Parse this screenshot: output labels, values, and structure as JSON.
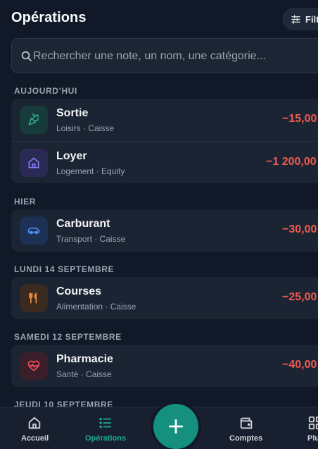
{
  "header": {
    "title": "Opérations",
    "filter_label": "Filtrer"
  },
  "search": {
    "placeholder": "Rechercher une note, un nom, une catégorie..."
  },
  "sections": [
    {
      "label": "AUJOURD’HUI",
      "items": [
        {
          "title": "Sortie",
          "subtitle": "Loisirs · Caisse",
          "amount": "−15,00",
          "icon": "party-popper-icon",
          "icon_color": "#2fb39a",
          "icon_bg": "#173b3a"
        },
        {
          "title": "Loyer",
          "subtitle": "Logement · Equity",
          "amount": "−1 200,00",
          "icon": "home-icon",
          "icon_color": "#8b7cf6",
          "icon_bg": "#2a2a55"
        }
      ]
    },
    {
      "label": "HIER",
      "items": [
        {
          "title": "Carburant",
          "subtitle": "Transport · Caisse",
          "amount": "−30,00",
          "icon": "car-icon",
          "icon_color": "#4a8ef0",
          "icon_bg": "#1c3154"
        }
      ]
    },
    {
      "label": "LUNDI 14 SEPTEMBRE",
      "items": [
        {
          "title": "Courses",
          "subtitle": "Alimentation · Caisse",
          "amount": "−25,00",
          "icon": "utensils-icon",
          "icon_color": "#f08a3a",
          "icon_bg": "#3a2a20"
        }
      ]
    },
    {
      "label": "SAMEDI 12 SEPTEMBRE",
      "items": [
        {
          "title": "Pharmacie",
          "subtitle": "Santé · Caisse",
          "amount": "−40,00",
          "icon": "heart-pulse-icon",
          "icon_color": "#ef4d5e",
          "icon_bg": "#3a1f2a"
        }
      ]
    },
    {
      "label": "JEUDI 10 SEPTEMBRE",
      "items": []
    }
  ],
  "nav": {
    "home_label": "Accueil",
    "operations_label": "Opérations",
    "accounts_label": "Comptes",
    "more_label": "Plus"
  },
  "colors": {
    "accent": "#1fa894",
    "negative_amount": "#f05a4f",
    "background": "#111827",
    "card": "#1b2432"
  }
}
